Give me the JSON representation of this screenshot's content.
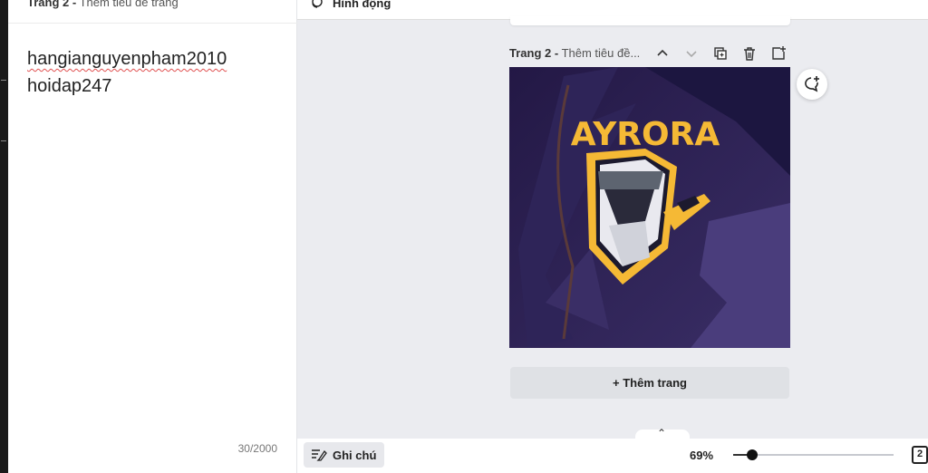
{
  "notes": {
    "header_page": "Trang 2 -",
    "header_subtitle": "Thêm tiêu đề trang",
    "lines": [
      "hangianguyenpham2010",
      "hoidap247"
    ],
    "char_count": "30/2000"
  },
  "toolbar": {
    "animate_label": "Hình động"
  },
  "page": {
    "title_prefix": "Trang 2 -",
    "title_placeholder": "Thêm tiêu đề...",
    "logo_text": "AYRORA",
    "add_page_label": "+ Thêm trang"
  },
  "bottom": {
    "notes_label": "Ghi chú",
    "zoom_label": "69%",
    "zoom_fraction": 0.12,
    "page_count": "2",
    "collapse_glyph": "⌃"
  },
  "colors": {
    "logo_yellow": "#f5b935",
    "page_bg": "#221a4a",
    "canvas_bg": "#ebecf0"
  },
  "icons": [
    "animate-icon",
    "chevron-up-icon",
    "chevron-down-icon",
    "duplicate-icon",
    "trash-icon",
    "add-page-icon",
    "comment-add-icon",
    "notes-icon",
    "page-grid-icon"
  ]
}
